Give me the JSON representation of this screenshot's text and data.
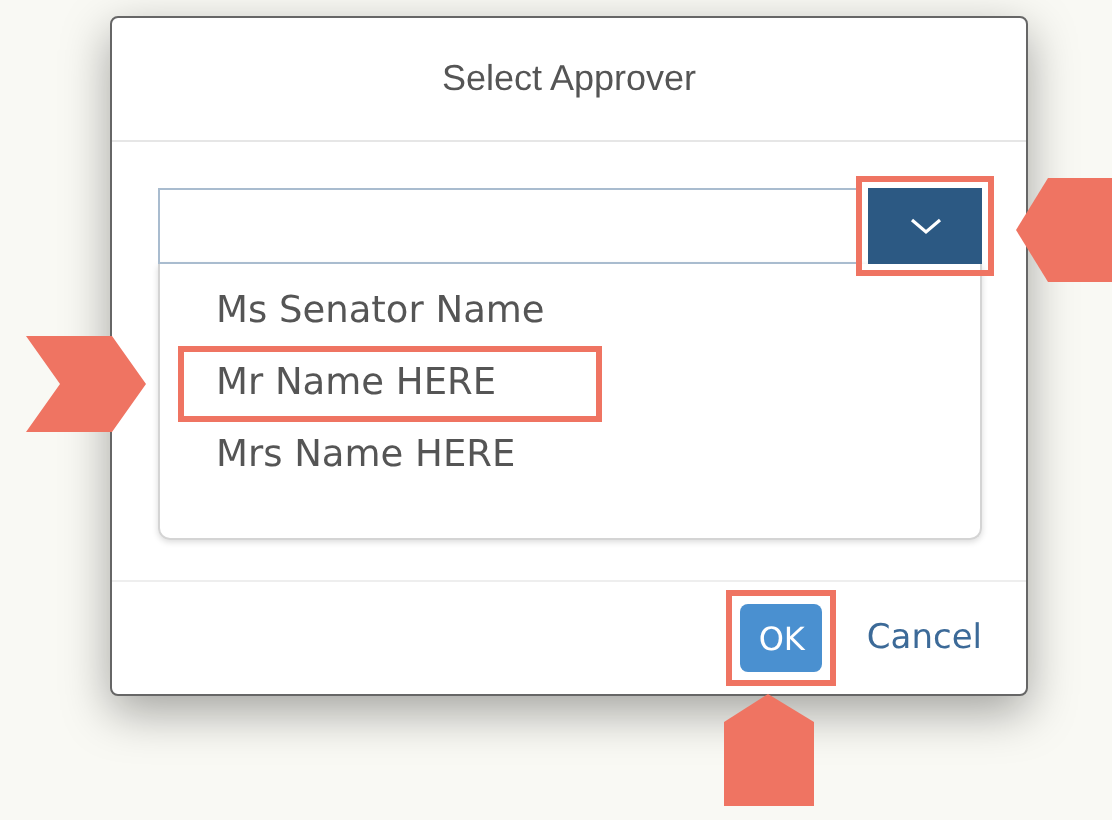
{
  "dialog": {
    "title": "Select Approver"
  },
  "dropdown_button": {
    "annotated": true
  },
  "options": [
    {
      "label": "Ms Senator Name",
      "annotated": false
    },
    {
      "label": "Mr Name HERE",
      "annotated": true
    },
    {
      "label": "Mrs Name HERE",
      "annotated": false
    }
  ],
  "buttons": [
    {
      "label": "OK",
      "kind": "primary",
      "annotated": true
    },
    {
      "label": "Cancel",
      "kind": "link",
      "annotated": false
    }
  ]
}
